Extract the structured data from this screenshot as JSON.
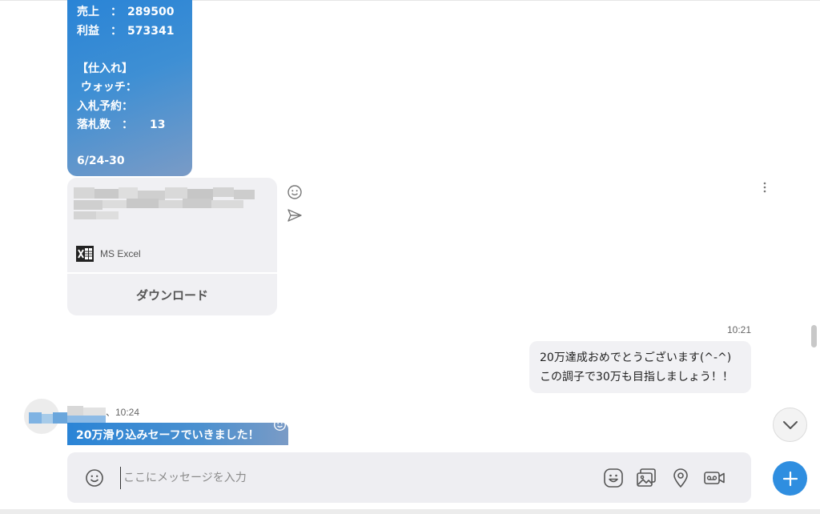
{
  "report": {
    "lines": [
      "売上　：　289500",
      "利益　：　573341",
      "",
      "【仕入れ】",
      " ウォッチ：",
      "入札予約：",
      "落札数　：　　13"
    ],
    "date": "6/24-30"
  },
  "file_card": {
    "file_type": "MS Excel",
    "download_label": "ダウンロード"
  },
  "outgoing": {
    "time": "10:21",
    "lines": [
      "20万達成おめでとうございます(^-^)",
      "この調子で30万も目指しましょう！！"
    ]
  },
  "incoming": {
    "sender_suffix": "、10:24",
    "text": "20万滑り込みセーフでいきました！"
  },
  "composer": {
    "placeholder": "ここにメッセージを入力"
  },
  "colors": {
    "accent_blue": "#2f8ee0",
    "bubble_gradient_start": "#2a84d6",
    "bubble_gradient_end": "#7a9bc6",
    "bubble_grey": "#f1f1f4"
  }
}
